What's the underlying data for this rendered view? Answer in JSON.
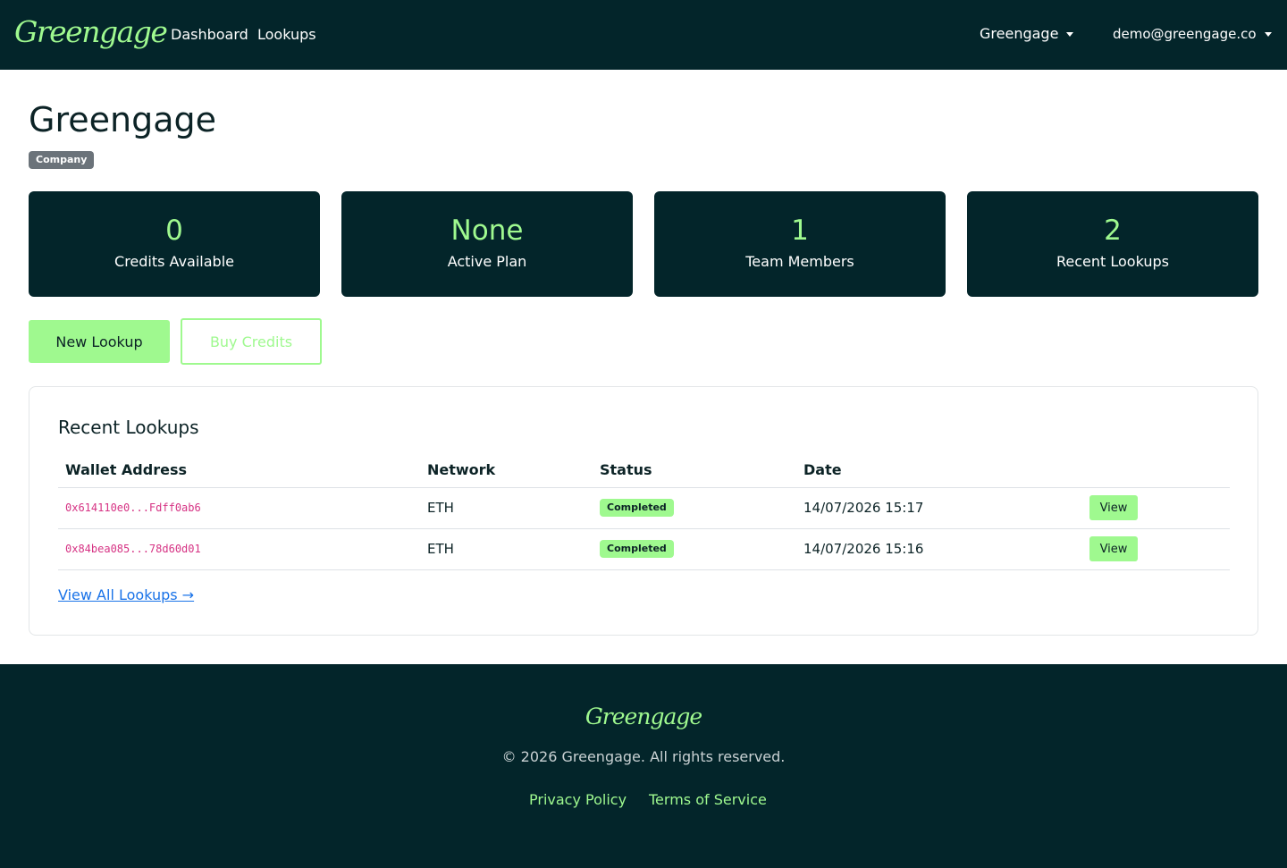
{
  "nav": {
    "brand": "Greengage",
    "links": [
      "Dashboard",
      "Lookups"
    ],
    "company_menu": "Greengage",
    "user_menu": "demo@greengage.co"
  },
  "header": {
    "title": "Greengage",
    "badge": "Company"
  },
  "stats": [
    {
      "value": "0",
      "label": "Credits Available"
    },
    {
      "value": "None",
      "label": "Active Plan"
    },
    {
      "value": "1",
      "label": "Team Members"
    },
    {
      "value": "2",
      "label": "Recent Lookups"
    }
  ],
  "actions": {
    "new_lookup": "New Lookup",
    "buy_credits": "Buy Credits"
  },
  "recent": {
    "title": "Recent Lookups",
    "columns": [
      "Wallet Address",
      "Network",
      "Status",
      "Date"
    ],
    "rows": [
      {
        "wallet": "0x614110e0...Fdff0ab6",
        "network": "ETH",
        "status": "Completed",
        "date": "14/07/2026 15:17",
        "action": "View"
      },
      {
        "wallet": "0x84bea085...78d60d01",
        "network": "ETH",
        "status": "Completed",
        "date": "14/07/2026 15:16",
        "action": "View"
      }
    ],
    "view_all": "View All Lookups →"
  },
  "footer": {
    "brand": "Greengage",
    "copyright": "© 2026 Greengage. All rights reserved.",
    "links": [
      "Privacy Policy",
      "Terms of Service"
    ]
  },
  "colors": {
    "navy": "#03252a",
    "accent": "#9ff98f",
    "wallet_text": "#d63384",
    "link": "#1a73e8"
  }
}
